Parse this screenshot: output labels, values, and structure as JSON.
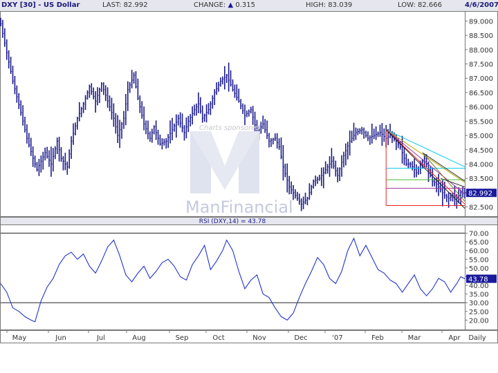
{
  "header": {
    "symbol": "DXY [30] - US Dollar",
    "last_label": "LAST:",
    "last_value": "82.992",
    "change_label": "CHANGE:",
    "change_arrow": "▲",
    "change_value": "0.315",
    "high_label": "HIGH:",
    "high_value": "83.039",
    "low_label": "LOW:",
    "low_value": "82.666",
    "date": "4/6/2007"
  },
  "watermark": {
    "sponsor_text": "Charts sponsored",
    "brand_text": "ManFinancial"
  },
  "chart_data": [
    {
      "type": "ohlc",
      "title": "DXY [30] - US Dollar",
      "ylim": [
        82.2,
        89.3
      ],
      "yticks": [
        "82.500",
        "83.000",
        "83.500",
        "84.000",
        "84.500",
        "85.000",
        "85.500",
        "86.000",
        "86.500",
        "87.000",
        "87.500",
        "88.000",
        "88.500",
        "89.000"
      ],
      "last_label": "82.992",
      "x_labels": [
        "May",
        "Jun",
        "Jul",
        "Aug",
        "Sep",
        "Oct",
        "Nov",
        "Dec",
        "'07",
        "Feb",
        "Mar",
        "Apr",
        "Daily"
      ],
      "close_path": [
        [
          0,
          88.9
        ],
        [
          3,
          87.9
        ],
        [
          6,
          86.9
        ],
        [
          10,
          85.8
        ],
        [
          13,
          84.9
        ],
        [
          16,
          84.2
        ],
        [
          18,
          83.8
        ],
        [
          22,
          84.4
        ],
        [
          25,
          84.0
        ],
        [
          28,
          84.8
        ],
        [
          30,
          84.2
        ],
        [
          33,
          83.9
        ],
        [
          35,
          84.8
        ],
        [
          38,
          85.6
        ],
        [
          41,
          86.1
        ],
        [
          44,
          86.7
        ],
        [
          47,
          86.2
        ],
        [
          50,
          86.8
        ],
        [
          53,
          86.2
        ],
        [
          56,
          85.6
        ],
        [
          58,
          85.0
        ],
        [
          61,
          85.6
        ],
        [
          63,
          86.6
        ],
        [
          66,
          87.1
        ],
        [
          68,
          86.3
        ],
        [
          71,
          85.4
        ],
        [
          74,
          84.9
        ],
        [
          76,
          85.3
        ],
        [
          79,
          84.7
        ],
        [
          82,
          84.8
        ],
        [
          85,
          85.2
        ],
        [
          88,
          85.6
        ],
        [
          91,
          85.1
        ],
        [
          93,
          85.5
        ],
        [
          96,
          85.9
        ],
        [
          98,
          86.1
        ],
        [
          100,
          85.6
        ],
        [
          103,
          85.9
        ],
        [
          106,
          86.5
        ],
        [
          109,
          86.9
        ],
        [
          112,
          87.1
        ],
        [
          115,
          86.6
        ],
        [
          118,
          86.2
        ],
        [
          121,
          85.7
        ],
        [
          124,
          85.9
        ],
        [
          127,
          85.1
        ],
        [
          130,
          85.4
        ],
        [
          133,
          84.8
        ],
        [
          136,
          84.9
        ],
        [
          138,
          84.6
        ],
        [
          140,
          83.9
        ],
        [
          143,
          83.2
        ],
        [
          146,
          82.9
        ],
        [
          149,
          82.6
        ],
        [
          152,
          82.8
        ],
        [
          155,
          83.4
        ],
        [
          158,
          83.5
        ],
        [
          161,
          83.8
        ],
        [
          164,
          84.1
        ],
        [
          167,
          83.6
        ],
        [
          170,
          84.3
        ],
        [
          173,
          84.8
        ],
        [
          176,
          85.1
        ],
        [
          179,
          85.2
        ],
        [
          182,
          84.9
        ],
        [
          185,
          85.0
        ],
        [
          188,
          85.1
        ],
        [
          191,
          84.9
        ],
        [
          193,
          85.0
        ],
        [
          196,
          84.8
        ],
        [
          198,
          84.6
        ],
        [
          201,
          84.0
        ],
        [
          203,
          84.0
        ],
        [
          206,
          83.7
        ],
        [
          208,
          84.0
        ],
        [
          210,
          84.2
        ],
        [
          212,
          83.8
        ],
        [
          214,
          83.4
        ],
        [
          216,
          83.3
        ],
        [
          218,
          83.1
        ],
        [
          220,
          82.9
        ],
        [
          222,
          82.8
        ],
        [
          224,
          82.9
        ],
        [
          226,
          82.8
        ],
        [
          228,
          83.0
        ],
        [
          230,
          82.99
        ]
      ],
      "close_x_range": [
        0,
        230
      ],
      "horizontal_levels": [
        {
          "value": 83.85,
          "color": "#00ccee"
        },
        {
          "value": 83.45,
          "color": "#44bb33"
        },
        {
          "value": 83.15,
          "color": "#993399"
        },
        {
          "value": 82.55,
          "color": "#ee2222"
        }
      ],
      "fan_lines": [
        {
          "from": [
            191,
            85.2
          ],
          "to": [
            230,
            83.9
          ],
          "color": "#00ccee"
        },
        {
          "from": [
            191,
            85.2
          ],
          "to": [
            230,
            83.35
          ],
          "color": "#bbaa00"
        },
        {
          "from": [
            191,
            85.2
          ],
          "to": [
            230,
            82.95
          ],
          "color": "#993399"
        },
        {
          "from": [
            191,
            85.2
          ],
          "to": [
            230,
            82.6
          ],
          "color": "#ee2222"
        },
        {
          "from": [
            191,
            85.2
          ],
          "to": [
            230,
            82.45
          ],
          "color": "#222222"
        },
        {
          "from": [
            209,
            84.4
          ],
          "to": [
            230,
            83.4
          ],
          "color": "#333333"
        },
        {
          "from": [
            209,
            84.4
          ],
          "to": [
            230,
            82.7
          ],
          "color": "#777733"
        },
        {
          "from": [
            218,
            83.5
          ],
          "to": [
            230,
            83.2
          ],
          "color": "#333333"
        }
      ],
      "vertical_fan_x": 191,
      "vertical_fan_range": [
        82.55,
        85.2
      ]
    },
    {
      "type": "line",
      "title": "RSI (DXY,14) = 43.78",
      "ylim": [
        15,
        73
      ],
      "yticks": [
        "20.00",
        "25.00",
        "30.00",
        "35.00",
        "40.00",
        "45.00",
        "50.00",
        "55.00",
        "60.00",
        "65.00",
        "70.00"
      ],
      "reference_lines": [
        70,
        30
      ],
      "last_label": "43.78",
      "x": [
        0,
        3,
        6,
        9,
        12,
        15,
        17,
        20,
        23,
        26,
        29,
        32,
        35,
        38,
        41,
        44,
        47,
        50,
        53,
        56,
        59,
        62,
        65,
        68,
        71,
        74,
        77,
        80,
        83,
        86,
        89,
        92,
        95,
        98,
        101,
        104,
        107,
        110,
        112,
        115,
        118,
        121,
        124,
        127,
        130,
        133,
        136,
        139,
        142,
        145,
        148,
        151,
        154,
        157,
        160,
        163,
        166,
        169,
        172,
        175,
        178,
        181,
        184,
        187,
        190,
        193,
        196,
        199,
        202,
        205,
        208,
        211,
        214,
        217,
        220,
        223,
        226,
        228,
        230
      ],
      "values": [
        41,
        36,
        27,
        25,
        22,
        20,
        19,
        31,
        39,
        44,
        52,
        57,
        59,
        55,
        58,
        51,
        47,
        54,
        62,
        66,
        57,
        46,
        42,
        47,
        51,
        44,
        48,
        53,
        55,
        51,
        45,
        43,
        52,
        57,
        63,
        49,
        54,
        60,
        66,
        60,
        48,
        38,
        43,
        46,
        35,
        33,
        27,
        22,
        20,
        24,
        33,
        41,
        48,
        56,
        52,
        44,
        41,
        48,
        60,
        67,
        57,
        63,
        56,
        49,
        47,
        43,
        41,
        36,
        41,
        46,
        38,
        34,
        38,
        44,
        42,
        36,
        41,
        45,
        43.78
      ]
    }
  ]
}
